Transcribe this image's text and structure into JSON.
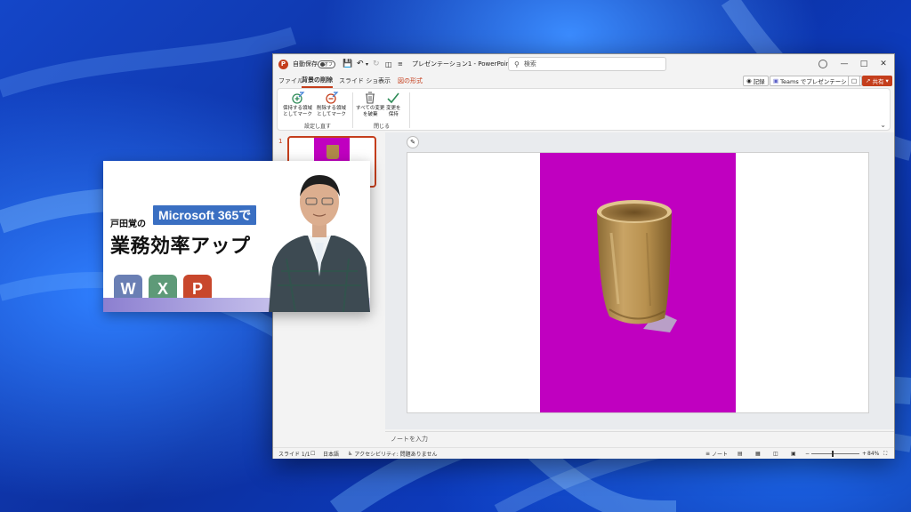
{
  "window": {
    "autosave_label": "自動保存",
    "autosave_state": "オフ",
    "title": "プレゼンテーション1 - PowerPoint",
    "search_placeholder": "検索"
  },
  "tabs": [
    "ファイル",
    "背景の削除",
    "スライド ショー",
    "表示",
    "図の形式"
  ],
  "top_buttons": {
    "record": "記録",
    "teams": "Teams でプレゼンテーション",
    "share": "共有"
  },
  "ribbon": {
    "mark_keep": [
      "保持する領域",
      "としてマーク"
    ],
    "mark_remove": [
      "削除する領域",
      "としてマーク"
    ],
    "discard": [
      "すべての変更",
      "を破棄"
    ],
    "keep_changes": [
      "変更を",
      "保持"
    ],
    "group_refine": "設定し直す",
    "group_close": "閉じる"
  },
  "slide_panel": {
    "slide_number": "1"
  },
  "notes_placeholder": "ノートを入力",
  "status": {
    "slide_info": "スライド 1/1",
    "language": "日本語",
    "accessibility": "アクセシビリティ: 問題ありません",
    "notes": "ノート",
    "zoom": "84%"
  },
  "banner": {
    "prefix": "戸田覚の",
    "product": "Microsoft 365で",
    "headline": "業務効率アップ",
    "apps": [
      {
        "letter": "W",
        "color": "#6a7fb4"
      },
      {
        "letter": "X",
        "color": "#5e9a78"
      },
      {
        "letter": "P",
        "color": "#c8472c"
      }
    ]
  },
  "colors": {
    "accent": "#c43e1c",
    "slide_background": "#c000c0"
  }
}
